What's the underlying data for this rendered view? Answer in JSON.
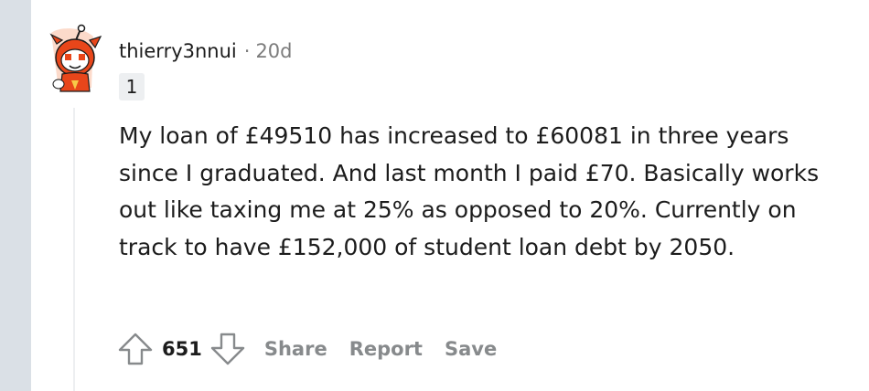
{
  "comment": {
    "author": "thierry3nnui",
    "separator": "·",
    "age": "20d",
    "flair": "1",
    "body": "My loan of £49510 has increased to £60081 in three years since I graduated. And last month I paid £70. Basically works out like taxing me at 25% as opposed to 20%. Currently on track to have £152,000 of student loan debt by 2050.",
    "score": "651"
  },
  "actions": {
    "share_label": "Share",
    "report_label": "Report",
    "save_label": "Save"
  },
  "icons": {
    "avatar": "snoo-avatar-icon",
    "upvote": "arrow-up-icon",
    "downvote": "arrow-down-icon"
  },
  "colors": {
    "avatar_primary": "#e8461a",
    "text_primary": "#1c1c1c",
    "text_secondary": "#878a8c",
    "gutter": "#dae0e6"
  }
}
